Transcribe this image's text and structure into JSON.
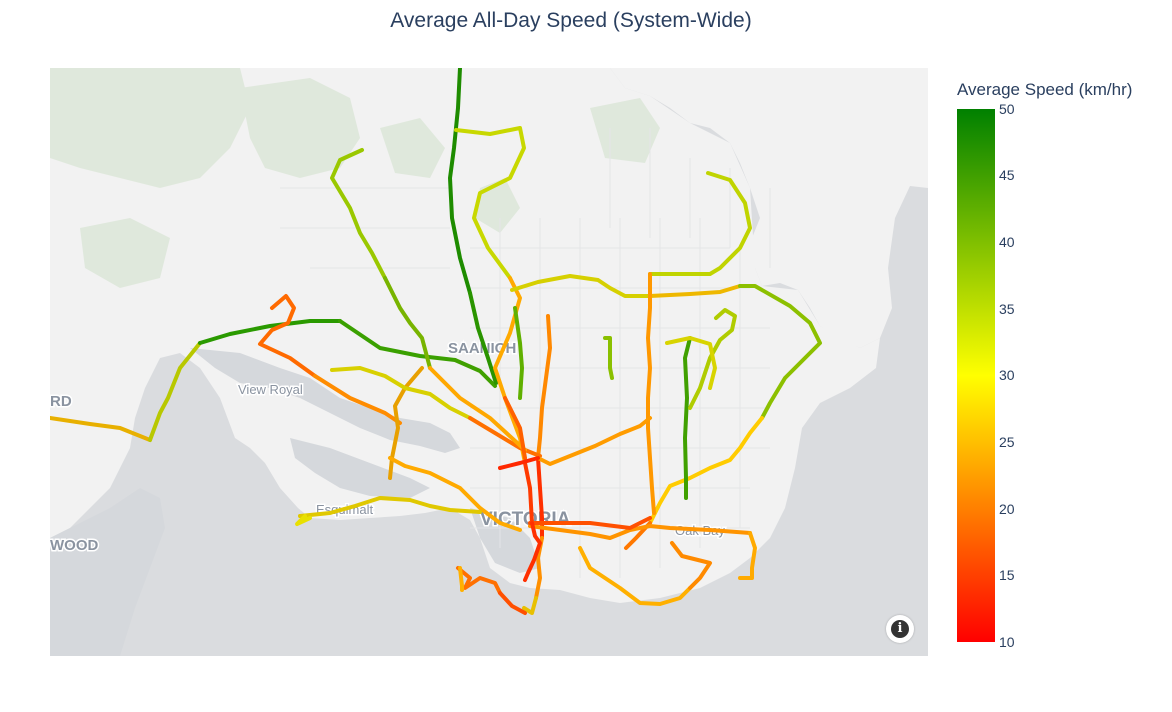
{
  "title": "Average All-Day Speed (System-Wide)",
  "colorbar": {
    "title": "Average Speed (km/hr)",
    "min": 10,
    "max": 50,
    "ticks": [
      "50",
      "45",
      "40",
      "35",
      "30",
      "25",
      "20",
      "15",
      "10"
    ],
    "colors": {
      "low": "#ff0000",
      "mid": "#ffff00",
      "high": "#008000"
    }
  },
  "map": {
    "labels": [
      "SAANICH",
      "View Royal",
      "VICTORIA",
      "Esquimalt",
      "Oak Bay",
      "RD",
      "WOOD"
    ],
    "info_icon": "info-icon"
  }
}
